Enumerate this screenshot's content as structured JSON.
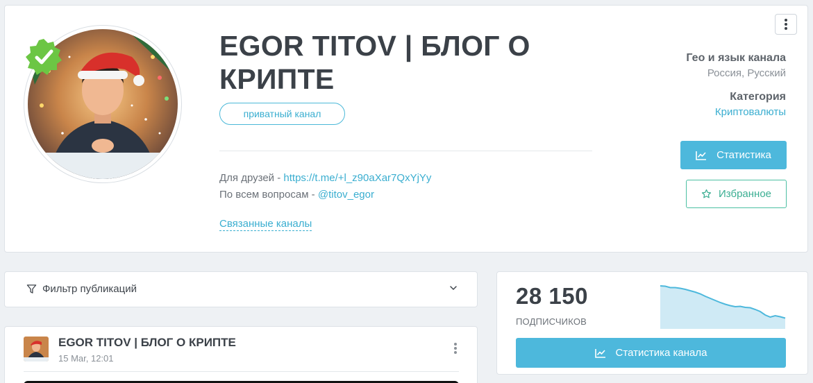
{
  "header": {
    "title": "EGOR TITOV | БЛОГ О КРИПТЕ",
    "privacy_badge": "приватный канал",
    "description": {
      "line1_prefix": "Для друзей - ",
      "line1_link": "https://t.me/+l_z90aXar7QxYjYy",
      "line2_prefix": "По всем вопросам - ",
      "line2_link": "@titov_egor"
    },
    "related_channels_link": "Связанные каналы",
    "geo_label": "Гео и язык канала",
    "geo_value": "Россия, Русский",
    "category_label": "Категория",
    "category_value": "Криптовалюты",
    "stats_button": "Статистика",
    "favorite_button": "Избранное",
    "more_icon": "vertical-dots-icon",
    "verified_icon": "verified-check-icon"
  },
  "filter": {
    "label": "Фильтр публикаций",
    "icon": "funnel-icon",
    "chevron_icon": "chevron-down-icon"
  },
  "post": {
    "author": "EGOR TITOV | БЛОГ О КРИПТЕ",
    "date": "15 Mar, 12:01"
  },
  "subscribers": {
    "count": "28 150",
    "label": "ПОДПИСЧИКОВ",
    "button": "Статистика канала",
    "trend": [
      1.0,
      0.99,
      0.95,
      0.95,
      0.93,
      0.9,
      0.86,
      0.82,
      0.77,
      0.7,
      0.64,
      0.58,
      0.52,
      0.47,
      0.43,
      0.4,
      0.41,
      0.38,
      0.37,
      0.32,
      0.26,
      0.16,
      0.1,
      0.14,
      0.11,
      0.07
    ]
  },
  "colors": {
    "accent": "#4db8dc",
    "link": "#3aaed0",
    "favorite": "#3bae92",
    "verified": "#6cc644"
  }
}
